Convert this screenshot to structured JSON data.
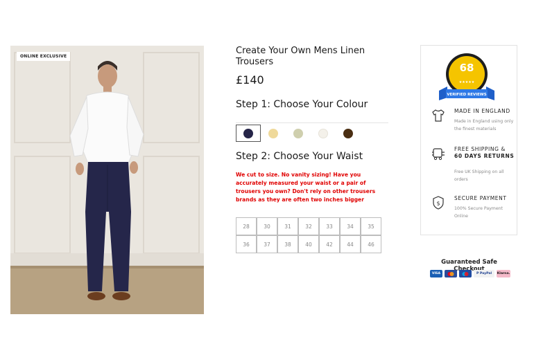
{
  "product": {
    "badge": "ONLINE EXCLUSIVE",
    "title": "Create Your Own Mens Linen Trousers",
    "price": "£140"
  },
  "colour_step": {
    "heading": "Step 1: Choose Your Colour",
    "swatches": [
      {
        "name": "navy",
        "color": "#262548",
        "selected": true
      },
      {
        "name": "sand",
        "color": "#efd99a",
        "selected": false
      },
      {
        "name": "sage",
        "color": "#cfcfae",
        "selected": false
      },
      {
        "name": "cream",
        "color": "#f4f1ea",
        "selected": false
      },
      {
        "name": "brown",
        "color": "#4a2e12",
        "selected": false
      }
    ]
  },
  "waist_step": {
    "heading": "Step 2: Choose Your Waist",
    "warning": "We cut to size. No vanity sizing! Have you accurately measured your waist or a pair of trousers you own? Don't rely on other trousers brands as they are often two inches bigger",
    "sizes": [
      "28",
      "30",
      "31",
      "32",
      "33",
      "34",
      "35",
      "36",
      "37",
      "38",
      "40",
      "42",
      "44",
      "46"
    ]
  },
  "reviews": {
    "score": "68",
    "label": "VERIFIED REVIEWS"
  },
  "features": [
    {
      "icon": "shirt-icon",
      "title": "MADE IN ENGLAND",
      "title_bold": "",
      "desc": "Made in England using only the finest materials"
    },
    {
      "icon": "delivery-truck-icon",
      "title": "FREE SHIPPING &",
      "title_bold": "60 DAYS RETURNS",
      "desc": "Free UK Shipping on all orders"
    },
    {
      "icon": "shield-dollar-icon",
      "title": "SECURE PAYMENT",
      "title_bold": "",
      "desc": "100% Secure Payment Online"
    }
  ],
  "checkout": {
    "title": "Guaranteed Safe Checkout",
    "methods": [
      {
        "name": "VISA",
        "bg": "#1a5fb4"
      },
      {
        "name": "Mastercard",
        "bg": "#2b4c9b"
      },
      {
        "name": "Maestro",
        "bg": "#1f4aa0"
      },
      {
        "name": "P PayPal",
        "bg": "#f2f2f2"
      },
      {
        "name": "Klarna.",
        "bg": "#f5b9c9"
      }
    ]
  }
}
